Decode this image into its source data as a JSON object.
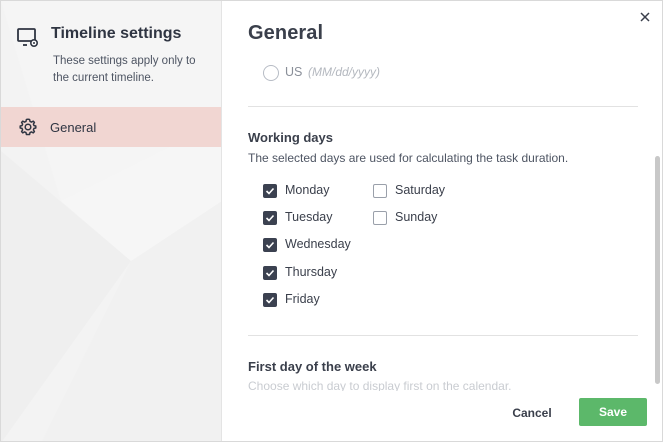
{
  "sidebar": {
    "title": "Timeline settings",
    "subtitle": "These settings apply only to the current timeline.",
    "items": [
      {
        "label": "General",
        "icon": "gear-icon",
        "active": true
      }
    ]
  },
  "main": {
    "title": "General",
    "date_format": {
      "option_label": "US",
      "option_hint": "(MM/dd/yyyy)",
      "selected": false
    },
    "working_days": {
      "title": "Working days",
      "description": "The selected days are used for calculating the task duration.",
      "days": [
        {
          "label": "Monday",
          "checked": true
        },
        {
          "label": "Tuesday",
          "checked": true
        },
        {
          "label": "Wednesday",
          "checked": true
        },
        {
          "label": "Thursday",
          "checked": true
        },
        {
          "label": "Friday",
          "checked": true
        },
        {
          "label": "Saturday",
          "checked": false
        },
        {
          "label": "Sunday",
          "checked": false
        }
      ]
    },
    "first_day": {
      "title": "First day of the week",
      "description": "Choose which day to display first on the calendar."
    }
  },
  "footer": {
    "cancel_label": "Cancel",
    "save_label": "Save"
  },
  "colors": {
    "accent_save": "#5cb86a",
    "sidebar_active": "#f1d6d2",
    "checkbox_checked": "#3b4150"
  }
}
